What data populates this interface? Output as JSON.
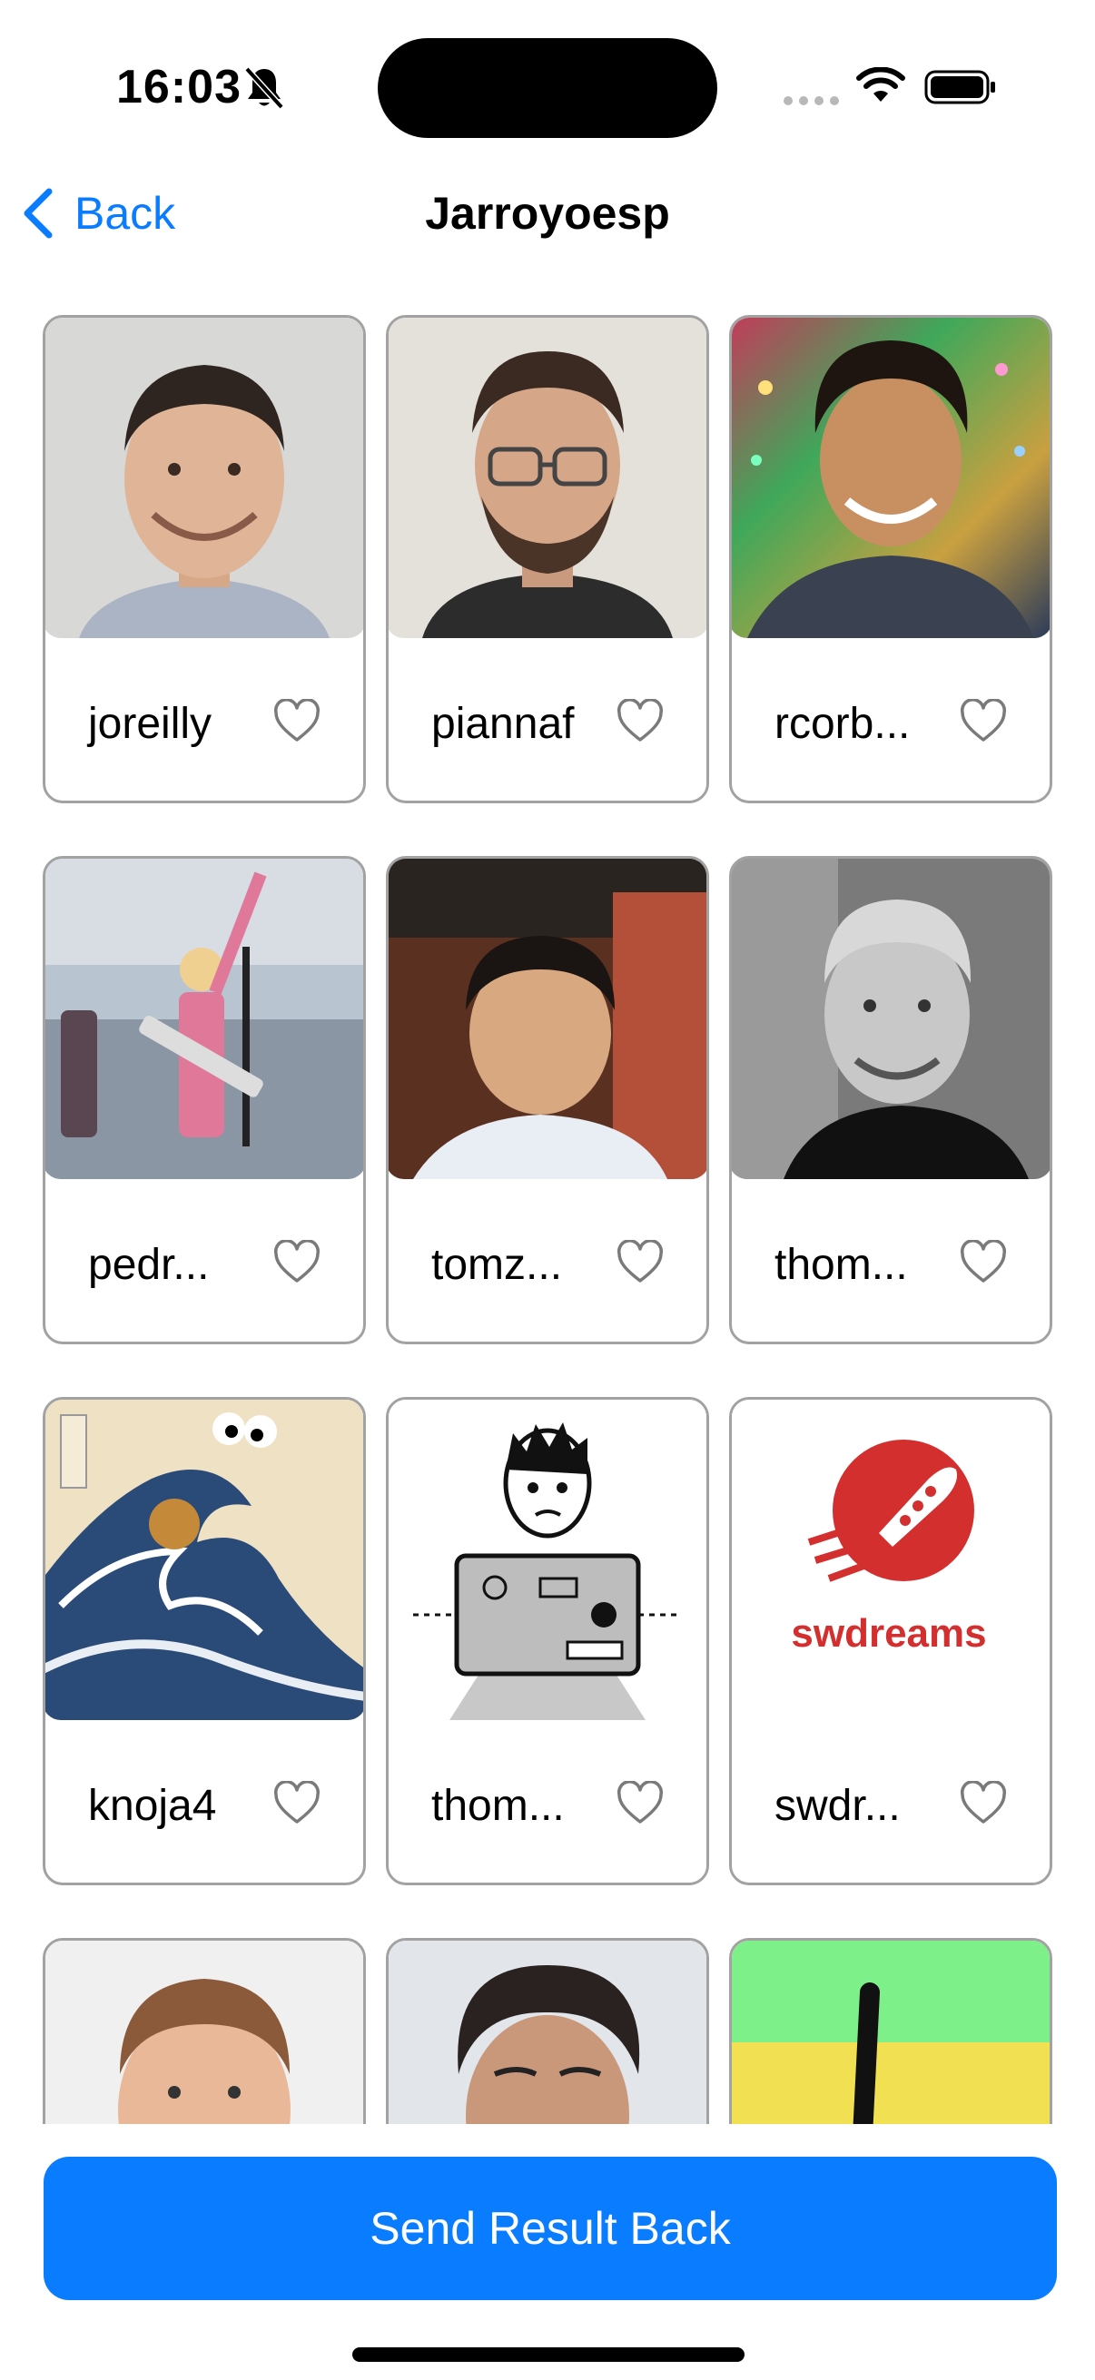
{
  "status_bar": {
    "time": "16:03"
  },
  "nav": {
    "back_label": "Back",
    "title": "Jarroyoesp"
  },
  "users": [
    {
      "name": "joreilly"
    },
    {
      "name": "piannaf"
    },
    {
      "name": "rcorb..."
    },
    {
      "name": "pedr..."
    },
    {
      "name": "tomz..."
    },
    {
      "name": "thom..."
    },
    {
      "name": "knoja4"
    },
    {
      "name": "thom..."
    },
    {
      "name": "swdr..."
    },
    {
      "name": ""
    },
    {
      "name": ""
    },
    {
      "name": ""
    }
  ],
  "logo_text": "swdreams",
  "send_button": {
    "label": "Send Result Back"
  },
  "colors": {
    "accent": "#0a7cff",
    "card_border": "#a2a2a2",
    "logo_red": "#d32f2f"
  }
}
